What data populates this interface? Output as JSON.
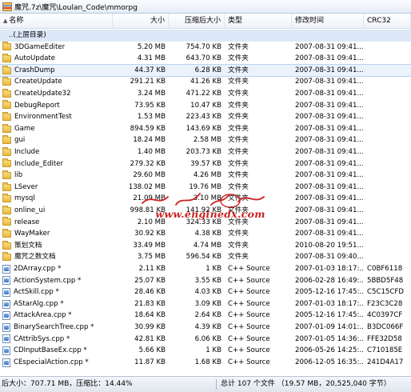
{
  "path": "魔咒.7z\\魔咒\\Loulan_Code\\mmorpg",
  "columns": {
    "name": "名称",
    "size": "大小",
    "packed": "压缩后大小",
    "type": "类型",
    "mtime": "修改时间",
    "crc": "CRC32"
  },
  "rows": [
    {
      "name": "..(上层目录)",
      "size": "",
      "packed": "",
      "type": "",
      "mtime": "",
      "crc": "",
      "kind": "up"
    },
    {
      "name": "3DGameEditer",
      "size": "5.20 MB",
      "packed": "754.70 KB",
      "type": "文件夹",
      "mtime": "2007-08-31 09:41...",
      "crc": "",
      "kind": "folder"
    },
    {
      "name": "AutoUpdate",
      "size": "4.31 MB",
      "packed": "643.70 KB",
      "type": "文件夹",
      "mtime": "2007-08-31 09:41...",
      "crc": "",
      "kind": "folder"
    },
    {
      "name": "CrashDump",
      "size": "44.37 KB",
      "packed": "6.28 KB",
      "type": "文件夹",
      "mtime": "2007-08-31 09:41...",
      "crc": "",
      "kind": "folder"
    },
    {
      "name": "CreateUpdate",
      "size": "291.21 KB",
      "packed": "41.26 KB",
      "type": "文件夹",
      "mtime": "2007-08-31 09:41...",
      "crc": "",
      "kind": "folder"
    },
    {
      "name": "CreateUpdate32",
      "size": "3.24 MB",
      "packed": "471.22 KB",
      "type": "文件夹",
      "mtime": "2007-08-31 09:41...",
      "crc": "",
      "kind": "folder"
    },
    {
      "name": "DebugReport",
      "size": "73.95 KB",
      "packed": "10.47 KB",
      "type": "文件夹",
      "mtime": "2007-08-31 09:41...",
      "crc": "",
      "kind": "folder"
    },
    {
      "name": "EnvironmentTest",
      "size": "1.53 MB",
      "packed": "223.43 KB",
      "type": "文件夹",
      "mtime": "2007-08-31 09:41...",
      "crc": "",
      "kind": "folder"
    },
    {
      "name": "Game",
      "size": "894.59 KB",
      "packed": "143.69 KB",
      "type": "文件夹",
      "mtime": "2007-08-31 09:41...",
      "crc": "",
      "kind": "folder"
    },
    {
      "name": "gui",
      "size": "18.24 MB",
      "packed": "2.58 MB",
      "type": "文件夹",
      "mtime": "2007-08-31 09:41...",
      "crc": "",
      "kind": "folder"
    },
    {
      "name": "Include",
      "size": "1.40 MB",
      "packed": "203.73 KB",
      "type": "文件夹",
      "mtime": "2007-08-31 09:41...",
      "crc": "",
      "kind": "folder"
    },
    {
      "name": "Include_Editer",
      "size": "279.32 KB",
      "packed": "39.57 KB",
      "type": "文件夹",
      "mtime": "2007-08-31 09:41...",
      "crc": "",
      "kind": "folder"
    },
    {
      "name": "lib",
      "size": "29.60 MB",
      "packed": "4.26 MB",
      "type": "文件夹",
      "mtime": "2007-08-31 09:41...",
      "crc": "",
      "kind": "folder"
    },
    {
      "name": "LSever",
      "size": "138.02 MB",
      "packed": "19.76 MB",
      "type": "文件夹",
      "mtime": "2007-08-31 09:41...",
      "crc": "",
      "kind": "folder"
    },
    {
      "name": "mysql",
      "size": "21.09 MB",
      "packed": "3.10 MB",
      "type": "文件夹",
      "mtime": "2007-08-31 09:41...",
      "crc": "",
      "kind": "folder"
    },
    {
      "name": "online_ui",
      "size": "998.81 KB",
      "packed": "141.92 KB",
      "type": "文件夹",
      "mtime": "2007-08-31 09:41...",
      "crc": "",
      "kind": "folder"
    },
    {
      "name": "release",
      "size": "2.10 MB",
      "packed": "324.33 KB",
      "type": "文件夹",
      "mtime": "2007-08-31 09:41...",
      "crc": "",
      "kind": "folder"
    },
    {
      "name": "WayMaker",
      "size": "30.92 KB",
      "packed": "4.38 KB",
      "type": "文件夹",
      "mtime": "2007-08-31 09:41...",
      "crc": "",
      "kind": "folder"
    },
    {
      "name": "策划文档",
      "size": "33.49 MB",
      "packed": "4.74 MB",
      "type": "文件夹",
      "mtime": "2010-08-20 19:51...",
      "crc": "",
      "kind": "folder"
    },
    {
      "name": "魔咒之数文档",
      "size": "3.75 MB",
      "packed": "596.54 KB",
      "type": "文件夹",
      "mtime": "2007-08-31 09:40...",
      "crc": "",
      "kind": "folder"
    },
    {
      "name": "2DArray.cpp *",
      "size": "2.11 KB",
      "packed": "1 KB",
      "type": "C++ Source",
      "mtime": "2007-01-03 18:17:...",
      "crc": "C0BF6118",
      "kind": "file"
    },
    {
      "name": "ActionSystem.cpp *",
      "size": "25.07 KB",
      "packed": "3.55 KB",
      "type": "C++ Source",
      "mtime": "2006-02-28 16:49:...",
      "crc": "5BBD5F48",
      "kind": "file"
    },
    {
      "name": "ActSkill.cpp *",
      "size": "28.46 KB",
      "packed": "4.03 KB",
      "type": "C++ Source",
      "mtime": "2005-12-16 17:45:...",
      "crc": "C5C15CFD",
      "kind": "file"
    },
    {
      "name": "AStarAlg.cpp *",
      "size": "21.83 KB",
      "packed": "3.09 KB",
      "type": "C++ Source",
      "mtime": "2007-01-03 18:17:...",
      "crc": "F23C3C28",
      "kind": "file"
    },
    {
      "name": "AttackArea.cpp *",
      "size": "18.64 KB",
      "packed": "2.64 KB",
      "type": "C++ Source",
      "mtime": "2005-12-16 17:45:...",
      "crc": "4C0397CF",
      "kind": "file"
    },
    {
      "name": "BinarySearchTree.cpp *",
      "size": "30.99 KB",
      "packed": "4.39 KB",
      "type": "C++ Source",
      "mtime": "2007-01-09 14:01:...",
      "crc": "B3DC066F",
      "kind": "file"
    },
    {
      "name": "CAttribSys.cpp *",
      "size": "42.81 KB",
      "packed": "6.06 KB",
      "type": "C++ Source",
      "mtime": "2007-01-05 14:36:...",
      "crc": "FFE32D58",
      "kind": "file"
    },
    {
      "name": "CDInputBaseEx.cpp *",
      "size": "5.66 KB",
      "packed": "1 KB",
      "type": "C++ Source",
      "mtime": "2006-05-26 14:25:...",
      "crc": "C710185E",
      "kind": "file"
    },
    {
      "name": "CEspecialAction.cpp *",
      "size": "11.87 KB",
      "packed": "1.68 KB",
      "type": "C++ Source",
      "mtime": "2006-12-05 16:35:...",
      "crc": "241D4A17",
      "kind": "file"
    }
  ],
  "watermark": {
    "script": "玩 攀 閣",
    "url": "www.enginedx.com"
  },
  "status": {
    "left": "后大小：707.71 MB，压缩比：14.44%",
    "right": "总计 107 个文件 （19.57 MB，20,525,040 字节）"
  },
  "colors": {
    "selected_row": "#eaf2fc",
    "up_row": "#dde8f8",
    "watermark": "#cc2222",
    "folder": "#e8b93c"
  }
}
